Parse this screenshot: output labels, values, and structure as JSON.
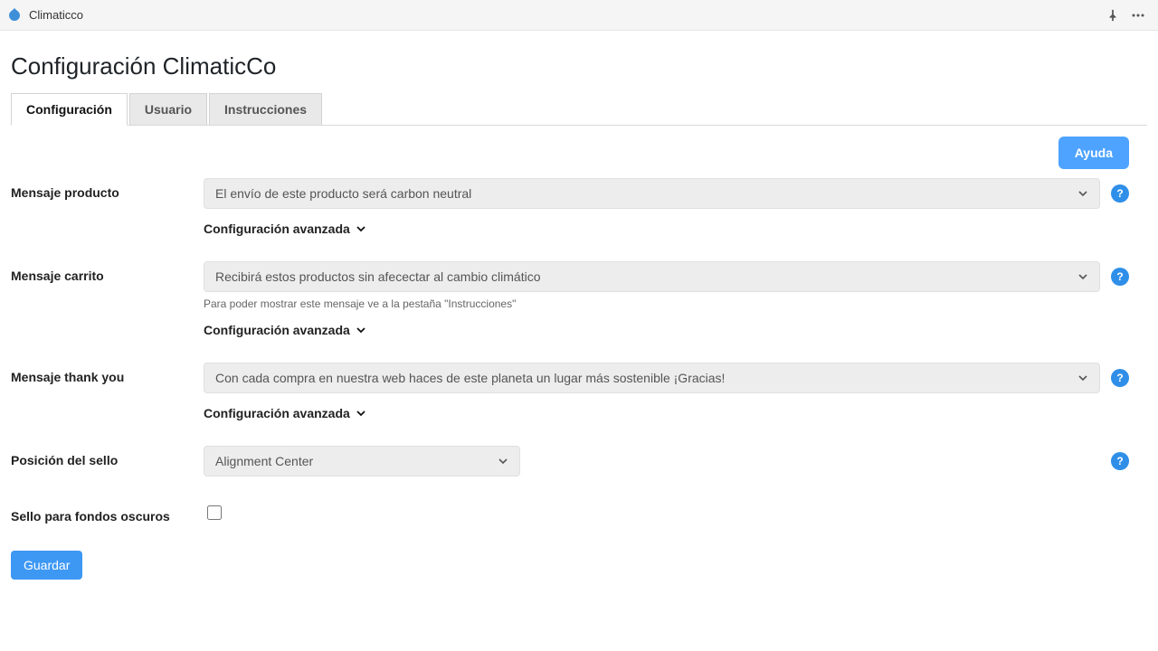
{
  "topbar": {
    "title": "Climaticco"
  },
  "page_title": "Configuración ClimaticCo",
  "tabs": {
    "configuracion": "Configuración",
    "usuario": "Usuario",
    "instrucciones": "Instrucciones"
  },
  "help_button": "Ayuda",
  "fields": {
    "mensaje_producto": {
      "label": "Mensaje producto",
      "value": "El envío de este producto será carbon neutral",
      "advanced": "Configuración avanzada"
    },
    "mensaje_carrito": {
      "label": "Mensaje carrito",
      "value": "Recibirá estos productos sin afecectar al cambio climático",
      "hint": "Para poder mostrar este mensaje ve a la pestaña \"Instrucciones\"",
      "advanced": "Configuración avanzada"
    },
    "mensaje_thank_you": {
      "label": "Mensaje thank you",
      "value": "Con cada compra en nuestra web haces de este planeta un lugar más sostenible ¡Gracias!",
      "advanced": "Configuración avanzada"
    },
    "posicion_sello": {
      "label": "Posición del sello",
      "value": "Alignment Center"
    },
    "sello_oscuro": {
      "label": "Sello para fondos oscuros"
    }
  },
  "save_button": "Guardar",
  "help_question_mark": "?"
}
